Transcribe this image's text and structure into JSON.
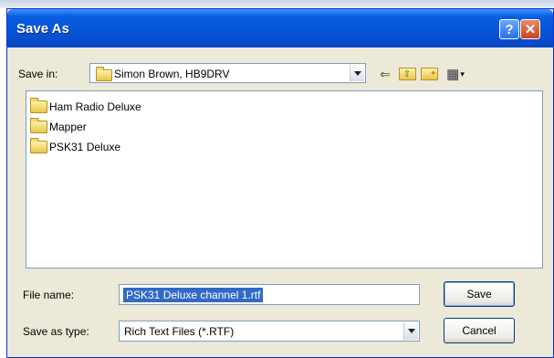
{
  "dialog": {
    "title": "Save As",
    "help_glyph": "?",
    "close_glyph": "✕"
  },
  "save_in": {
    "label": "Save in:",
    "value": "Simon Brown, HB9DRV"
  },
  "files": [
    {
      "name": "Ham Radio Deluxe"
    },
    {
      "name": "Mapper"
    },
    {
      "name": "PSK31 Deluxe"
    }
  ],
  "file_name": {
    "label": "File name:",
    "value": "PSK31 Deluxe channel 1.rtf"
  },
  "save_as_type": {
    "label": "Save as type:",
    "value": "Rich Text Files (*.RTF)"
  },
  "buttons": {
    "save": "Save",
    "cancel": "Cancel"
  },
  "toolbar": {
    "back_glyph": "⇐",
    "up_glyph": "⇧",
    "new_folder_glyph": "✦",
    "views_glyph": "▦"
  },
  "colors": {
    "title_bar": "#0553d8",
    "selection": "#316ac5",
    "dialog_bg": "#ece9d8"
  }
}
